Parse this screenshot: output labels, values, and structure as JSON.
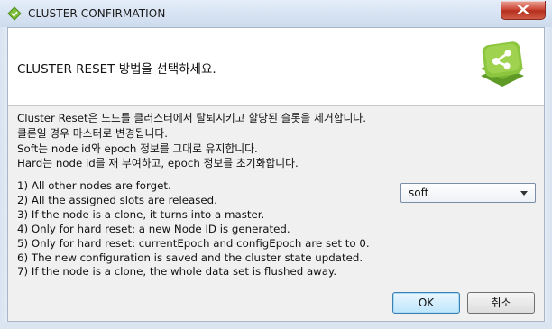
{
  "window": {
    "title": "CLUSTER CONFIRMATION",
    "close_icon": "close-icon",
    "app_icon": "app-diamond-icon"
  },
  "header": {
    "title": "CLUSTER RESET 방법을 선택하세요.",
    "logo_icon": "cluster-share-logo-icon"
  },
  "description": {
    "lines": [
      "Cluster Reset은 노드를 클러스터에서 탈퇴시키고 할당된 슬롯을 제거합니다.",
      "클론일 경우 마스터로 변경됩니다.",
      "Soft는 node id와 epoch 정보를 그대로 유지합니다.",
      "Hard는 node id를 재 부여하고, epoch 정보를 초기화합니다."
    ]
  },
  "steps": [
    "1) All other nodes are forget.",
    "2) All the assigned slots are released.",
    "3) If the node is a clone, it turns into a master.",
    "4) Only for hard reset: a new Node ID is generated.",
    "5) Only for hard reset: currentEpoch and configEpoch are set to 0.",
    "6) The new configuration is saved and the cluster state updated.",
    "7) If the node is a clone, the whole data set is flushed away."
  ],
  "reset_mode": {
    "selected": "soft"
  },
  "buttons": {
    "ok": "OK",
    "cancel": "취소"
  },
  "colors": {
    "logo_green": "#8cc63f",
    "close_red": "#c9402f",
    "ok_border": "#3c7fb1"
  }
}
